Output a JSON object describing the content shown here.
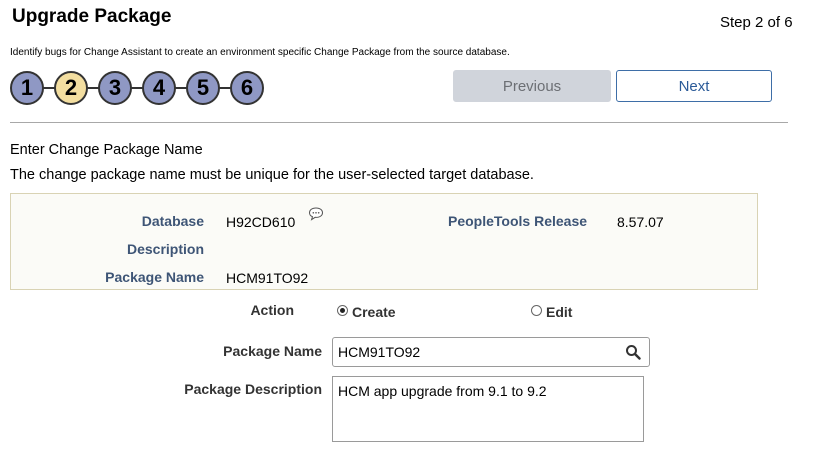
{
  "page": {
    "title": "Upgrade Package",
    "step_indicator": "Step 2 of 6",
    "instructions": "Identify bugs for Change Assistant to create an environment specific Change Package from the source database."
  },
  "train": {
    "steps": [
      "1",
      "2",
      "3",
      "4",
      "5",
      "6"
    ],
    "current": 2
  },
  "nav": {
    "previous_label": "Previous",
    "next_label": "Next"
  },
  "section": {
    "heading": "Enter Change Package Name",
    "description": "The change package name must be unique for the user-selected target database."
  },
  "info": {
    "database_label": "Database",
    "database_value": "H92CD610",
    "peopletools_label": "PeopleTools Release",
    "peopletools_value": "8.57.07",
    "description_label": "Description",
    "package_name_label": "Package Name",
    "package_name_value": "HCM91TO92"
  },
  "form": {
    "action_label": "Action",
    "action_options": [
      "Create",
      "Edit"
    ],
    "action_selected": "Create",
    "package_name_label": "Package Name",
    "package_name_value": "HCM91TO92",
    "package_description_label": "Package Description",
    "package_description_value": "HCM app upgrade from 9.1 to 9.2"
  },
  "icons": {
    "comment": "speech-bubble-icon",
    "lookup": "search-icon"
  },
  "colors": {
    "train_step": "#8f98c4",
    "train_current": "#f3dea0",
    "label_text": "#3e5576",
    "next_button_text": "#2a5a98",
    "prev_button_bg": "#d0d4db"
  }
}
